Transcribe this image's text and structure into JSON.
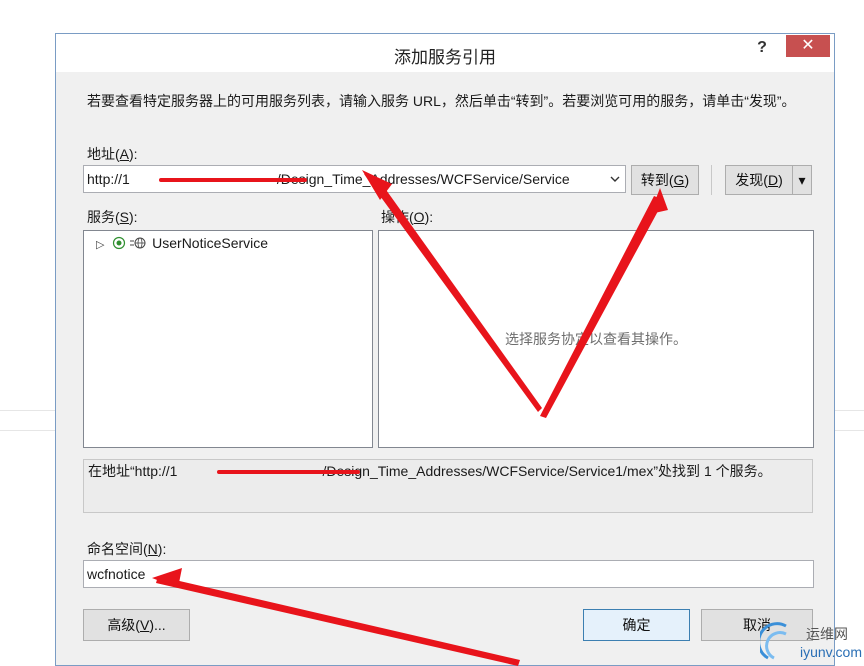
{
  "dialog": {
    "title": "添加服务引用",
    "help_label": "?",
    "close_label": "✕",
    "instructions": "若要查看特定服务器上的可用服务列表，请输入服务 URL，然后单击“转到”。若要浏览可用的服务，请单击“发现”。",
    "address": {
      "label_pre": "地址(",
      "label_key": "A",
      "label_post": "):",
      "prefix": "http://1",
      "value_tail": "/Design_Time_Addresses/WCFService/Service",
      "dropdown_icon": "chevron-down"
    },
    "goto_button": {
      "pre": "转到(",
      "key": "G",
      "post": ")"
    },
    "discover_button": {
      "pre": "发现(",
      "key": "D",
      "post": ")",
      "arrow": "▾"
    },
    "services": {
      "label_pre": "服务(",
      "label_key": "S",
      "label_post": "):",
      "items": [
        {
          "name": "UserNoticeService",
          "expand_icon": "▷"
        }
      ]
    },
    "operations": {
      "label_pre": "操作(",
      "label_key": "O",
      "label_post": "):",
      "placeholder": "选择服务协定以查看其操作。"
    },
    "status": {
      "pre": "在地址“http://1",
      "tail": "/Design_Time_Addresses/WCFService/Service1/mex”处找到 1 个服务。"
    },
    "namespace": {
      "label_pre": "命名空间(",
      "label_key": "N",
      "label_post": "):",
      "value": "wcfnotice"
    },
    "advanced_button": {
      "pre": "高级(",
      "key": "V",
      "post": ")..."
    },
    "ok_label": "确定",
    "cancel_label": "取消"
  },
  "watermark": {
    "cn": "运维网",
    "en": "iyunv.com"
  },
  "colors": {
    "annotation_red": "#e8141b",
    "close_button": "#c75050",
    "dialog_bg": "#f0f0f0",
    "watermark_blue": "#2a6fb5"
  }
}
